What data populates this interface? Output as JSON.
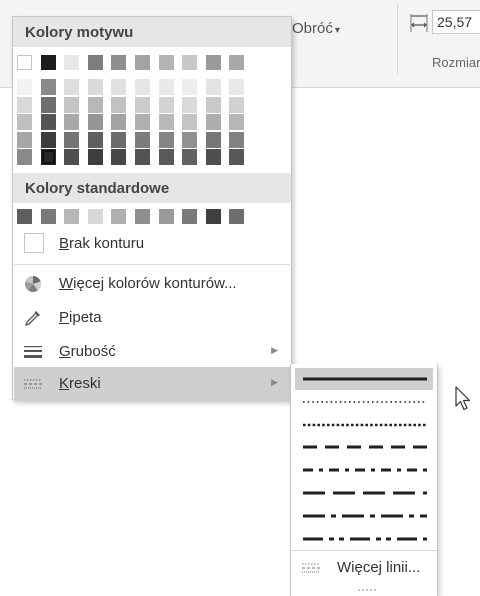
{
  "ribbon": {
    "rotate_label": "Obróć",
    "width_value": "25,57",
    "group_label": "Rozmiar"
  },
  "menu": {
    "theme_colors_header": "Kolory motywu",
    "standard_colors_header": "Kolory standardowe",
    "theme_top_row": [
      "#ffffff",
      "#1c1c1c",
      "#e8e8e8",
      "#7d7d7d",
      "#8f8f8f",
      "#a3a3a3",
      "#b4b4b4",
      "#c8c8c8",
      "#9a9a9a",
      "#a8a8a8"
    ],
    "theme_shade_columns": [
      [
        "#f2f2f2",
        "#d9d9d9",
        "#bfbfbf",
        "#a6a6a6",
        "#8a8a8a"
      ],
      [
        "#8a8a8a",
        "#6e6e6e",
        "#545454",
        "#3d3d3d",
        "#262626"
      ],
      [
        "#dedede",
        "#c4c4c4",
        "#a8a8a8",
        "#747474",
        "#4f4f4f"
      ],
      [
        "#dadada",
        "#b8b8b8",
        "#959595",
        "#5f5f5f",
        "#3e3e3e"
      ],
      [
        "#e0e0e0",
        "#c2c2c2",
        "#a3a3a3",
        "#6b6b6b",
        "#474747"
      ],
      [
        "#e6e6e6",
        "#cccccc",
        "#b0b0b0",
        "#7c7c7c",
        "#535353"
      ],
      [
        "#e9e9e9",
        "#d3d3d3",
        "#b9b9b9",
        "#858585",
        "#5a5a5a"
      ],
      [
        "#ededed",
        "#dadada",
        "#c4c4c4",
        "#909090",
        "#616161"
      ],
      [
        "#e3e3e3",
        "#c9c9c9",
        "#adadad",
        "#767676",
        "#4f4f4f"
      ],
      [
        "#e8e8e8",
        "#d1d1d1",
        "#b7b7b7",
        "#828282",
        "#575757"
      ]
    ],
    "standard_colors": [
      "#5e5e5e",
      "#7a7a7a",
      "#b8b8b8",
      "#d8d8d8",
      "#b0b0b0",
      "#8e8e8e",
      "#9a9a9a",
      "#7a7a7a",
      "#3f3f3f",
      "#6e6e6e"
    ],
    "no_outline": {
      "hotkey": "B",
      "rest": "rak konturu"
    },
    "more_colors": {
      "hotkey": "W",
      "rest": "ięcej kolorów konturów..."
    },
    "eyedropper": {
      "hotkey": "P",
      "rest": "ipeta"
    },
    "weight": {
      "hotkey": "G",
      "rest": "rubość"
    },
    "dashes": {
      "hotkey": "K",
      "rest": "reski"
    }
  },
  "submenu": {
    "dash_styles": [
      "solid",
      "round-dot",
      "square-dot",
      "dash",
      "dash-dot",
      "long-dash",
      "long-dash-dot",
      "long-dash-dot-dot"
    ],
    "more_lines_label": "Więcej linii..."
  },
  "icons": {
    "more_colors": "color-wheel-icon",
    "eyedropper": "eyedropper-icon",
    "weight": "line-weight-icon",
    "dashes": "dash-type-icon",
    "width": "shape-width-icon"
  }
}
